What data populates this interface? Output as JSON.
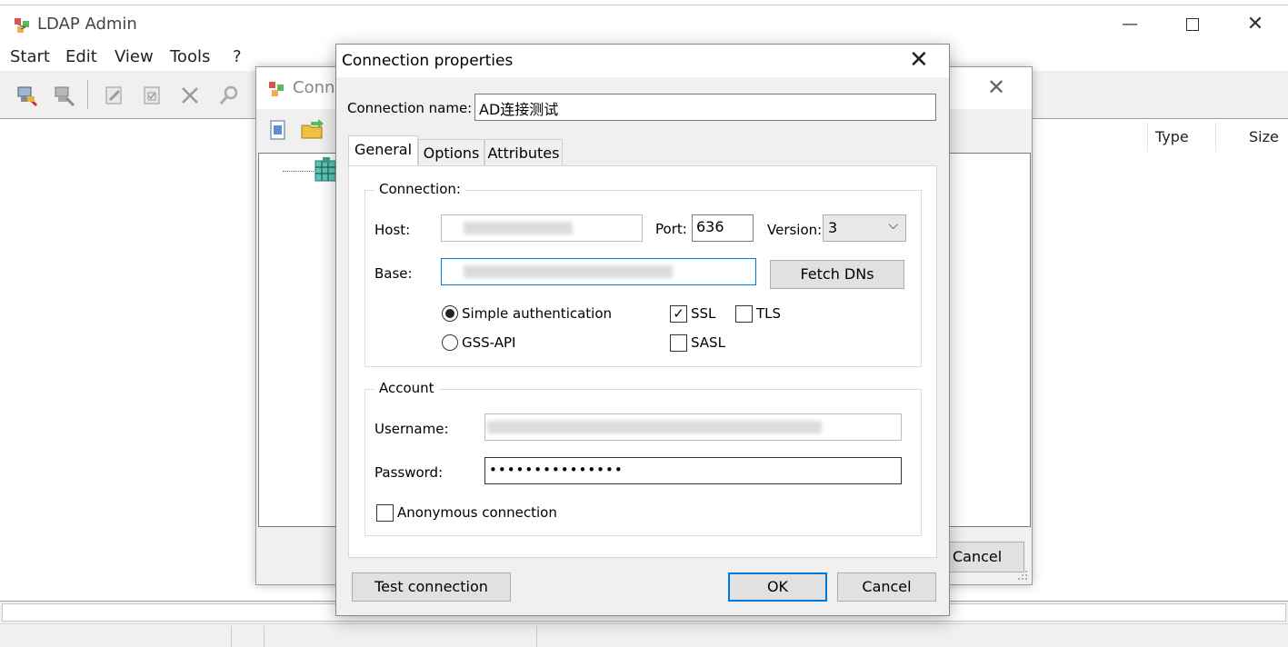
{
  "app": {
    "title": "LDAP Admin",
    "window_min": "—",
    "window_close": "✕"
  },
  "menu": [
    "Start",
    "Edit",
    "View",
    "Tools",
    "?"
  ],
  "list_columns": {
    "type": "Type",
    "size": "Size"
  },
  "connections_dialog": {
    "title": "Conne",
    "close": "✕",
    "cancel_label": "Cancel"
  },
  "props": {
    "title": "Connection properties",
    "close": "✕",
    "connection_name_label": "Connection name:",
    "connection_name_value": "AD连接测试",
    "tabs": [
      "General",
      "Options",
      "Attributes"
    ],
    "connection_group": "Connection:",
    "host_label": "Host:",
    "port_label": "Port:",
    "port_value": "636",
    "version_label": "Version:",
    "version_value": "3",
    "base_label": "Base:",
    "fetch_dns_label": "Fetch DNs",
    "simple_auth_label": "Simple authentication",
    "gss_api_label": "GSS-API",
    "ssl_label": "SSL",
    "tls_label": "TLS",
    "sasl_label": "SASL",
    "account_group": "Account",
    "username_label": "Username:",
    "password_label": "Password:",
    "password_value": "•••••••••••••••",
    "anonymous_label": "Anonymous connection",
    "test_connection_label": "Test connection",
    "ok_label": "OK",
    "cancel_label": "Cancel"
  },
  "state": {
    "simple_auth_selected": true,
    "ssl_checked": true,
    "tls_checked": false,
    "sasl_checked": false,
    "anonymous_checked": false
  }
}
